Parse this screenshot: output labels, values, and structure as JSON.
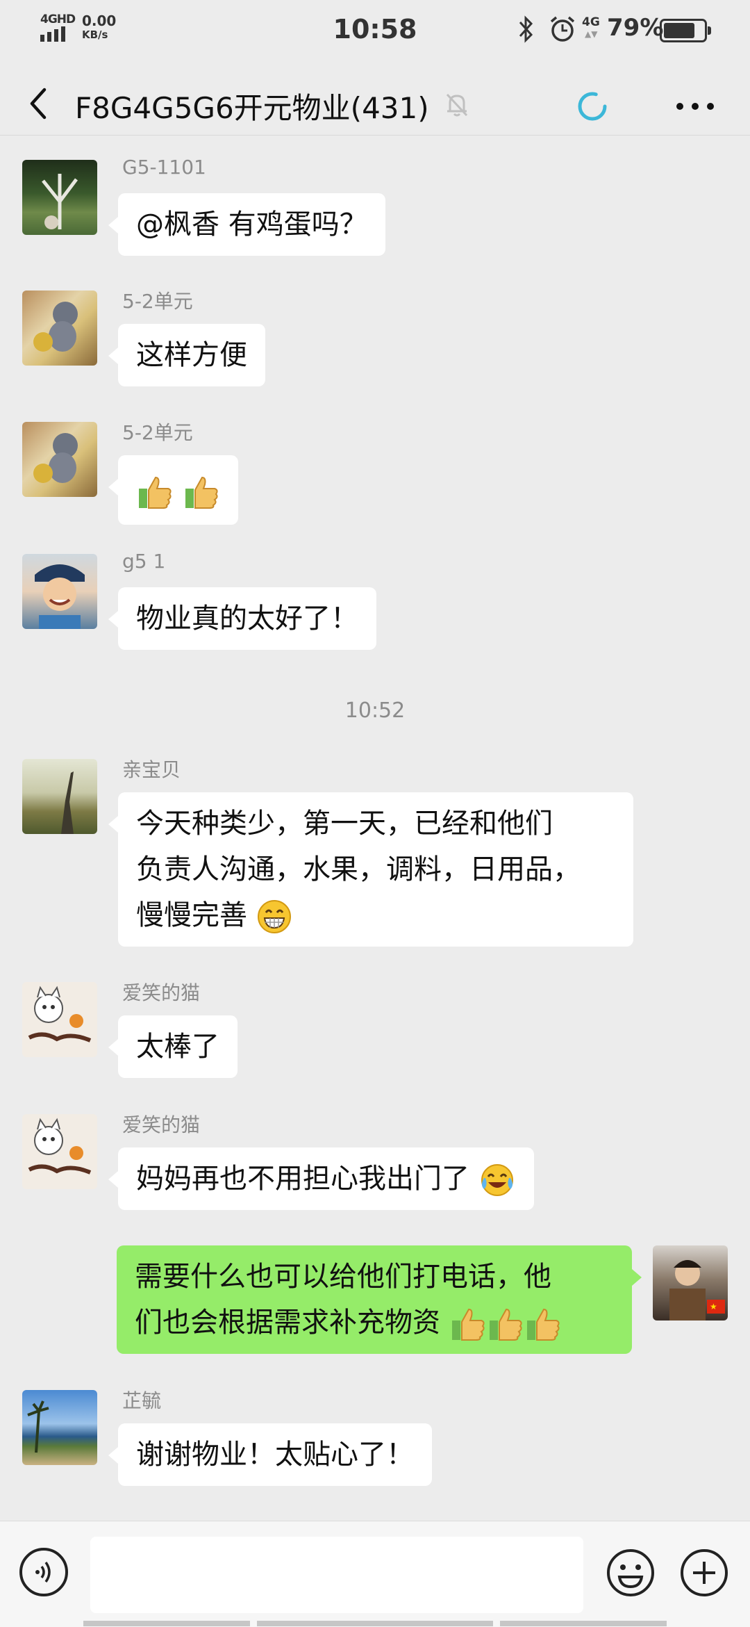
{
  "status_bar": {
    "network_gen": "4GHD",
    "speed_value": "0.00",
    "speed_unit": "KB/s",
    "time": "10:58",
    "mobile_net": "4G",
    "battery_percent": "79%",
    "battery_level": 0.79
  },
  "header": {
    "title": "F8G4G5G6开元物业(431)",
    "icons": [
      "back-arrow-icon",
      "mute-bell-icon",
      "loading-ring-icon",
      "more-dots-icon"
    ]
  },
  "colors": {
    "background": "#ececec",
    "incoming_bubble": "#ffffff",
    "outgoing_bubble": "#95ec69",
    "sender_name": "#8b8b8b",
    "loading_ring": "#3cb7d8"
  },
  "messages": [
    {
      "sender": "G5-1101",
      "text": "@枫香  有鸡蛋吗？"
    },
    {
      "sender": "5-2单元",
      "text": "这样方便"
    },
    {
      "sender": "5-2单元",
      "text": "",
      "emojis": [
        "thumbs-up-emoji",
        "thumbs-up-emoji"
      ]
    },
    {
      "sender": "g5 1",
      "text": "物业真的太好了！"
    },
    {
      "sender": "亲宝贝",
      "lines": [
        "今天种类少，第一天，已经和他们",
        "负责人沟通，水果，调料，日用品，",
        "慢慢完善"
      ],
      "emojis": [
        "grinning-emoji"
      ]
    },
    {
      "sender": "爱笑的猫",
      "text": "太棒了"
    },
    {
      "sender": "爱笑的猫",
      "text": "妈妈再也不用担心我出门了",
      "emojis": [
        "tears-of-joy-emoji"
      ]
    },
    {
      "sender": "me",
      "lines": [
        "需要什么也可以给他们打电话，他",
        "们也会根据需求补充物资"
      ],
      "emojis": [
        "thumbs-up-emoji",
        "thumbs-up-emoji",
        "thumbs-up-emoji"
      ]
    },
    {
      "sender": "芷毓",
      "text": "谢谢物业！太贴心了！"
    }
  ],
  "time_divider": "10:52",
  "input_bar": {
    "icons": [
      "voice-icon",
      "emoji-face-icon",
      "plus-icon"
    ],
    "placeholder": ""
  }
}
